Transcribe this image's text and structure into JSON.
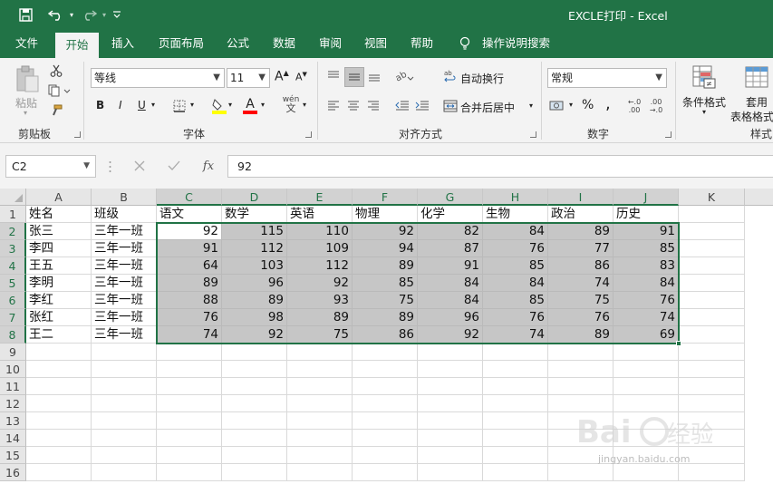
{
  "window": {
    "title": "EXCLE打印 - Excel"
  },
  "ribbon_tabs": [
    {
      "label": "文件",
      "active": false
    },
    {
      "label": "开始",
      "active": true
    },
    {
      "label": "插入",
      "active": false
    },
    {
      "label": "页面布局",
      "active": false
    },
    {
      "label": "公式",
      "active": false
    },
    {
      "label": "数据",
      "active": false
    },
    {
      "label": "审阅",
      "active": false
    },
    {
      "label": "视图",
      "active": false
    },
    {
      "label": "帮助",
      "active": false
    }
  ],
  "tell_me": "操作说明搜索",
  "ribbon": {
    "clipboard": {
      "label": "剪贴板",
      "paste": "粘贴"
    },
    "font": {
      "label": "字体",
      "font_name": "等线",
      "font_size": "11",
      "bold": "B",
      "italic": "I",
      "underline": "U",
      "font_color_glyph": "A",
      "phonetic_glyph": "wén",
      "grow_glyph": "A",
      "shrink_glyph": "A"
    },
    "alignment": {
      "label": "对齐方式",
      "wrap_text": "自动换行",
      "merge_center": "合并后居中"
    },
    "number": {
      "label": "数字",
      "format": "常规",
      "percent": "%",
      "comma": ","
    },
    "styles": {
      "label": "样式",
      "conditional": "条件格式",
      "table_format_1": "套用",
      "table_format_2": "表格格式"
    }
  },
  "formula_bar": {
    "name_box": "C2",
    "fx": "fx",
    "value": "92"
  },
  "sheet": {
    "columns": [
      "A",
      "B",
      "C",
      "D",
      "E",
      "F",
      "G",
      "H",
      "I",
      "J",
      "K"
    ],
    "row_numbers": [
      "1",
      "2",
      "3",
      "4",
      "5",
      "6",
      "7",
      "8",
      "9",
      "10",
      "11",
      "12",
      "13",
      "14",
      "15",
      "16"
    ],
    "header_row": [
      "姓名",
      "班级",
      "语文",
      "数学",
      "英语",
      "物理",
      "化学",
      "生物",
      "政治",
      "历史"
    ],
    "rows": [
      {
        "name": "张三",
        "class": "三年一班",
        "scores": [
          "92",
          "115",
          "110",
          "92",
          "82",
          "84",
          "89",
          "91"
        ]
      },
      {
        "name": "李四",
        "class": "三年一班",
        "scores": [
          "91",
          "112",
          "109",
          "94",
          "87",
          "76",
          "77",
          "85"
        ]
      },
      {
        "name": "王五",
        "class": "三年一班",
        "scores": [
          "64",
          "103",
          "112",
          "89",
          "91",
          "85",
          "86",
          "83"
        ]
      },
      {
        "name": "李明",
        "class": "三年一班",
        "scores": [
          "89",
          "96",
          "92",
          "85",
          "84",
          "84",
          "74",
          "84"
        ]
      },
      {
        "name": "李红",
        "class": "三年一班",
        "scores": [
          "88",
          "89",
          "93",
          "75",
          "84",
          "85",
          "75",
          "76"
        ]
      },
      {
        "name": "张红",
        "class": "三年一班",
        "scores": [
          "76",
          "98",
          "89",
          "89",
          "96",
          "76",
          "76",
          "74"
        ]
      },
      {
        "name": "王二",
        "class": "三年一班",
        "scores": [
          "74",
          "92",
          "75",
          "86",
          "92",
          "74",
          "89",
          "69"
        ]
      }
    ],
    "selected_columns": [
      "C",
      "D",
      "E",
      "F",
      "G",
      "H",
      "I",
      "J"
    ],
    "selected_rows": [
      "2",
      "3",
      "4",
      "5",
      "6",
      "7",
      "8"
    ]
  },
  "watermark": {
    "site": "jingyan.baidu.com"
  },
  "colors": {
    "brand": "#217346",
    "selection": "#c6c6c6"
  }
}
